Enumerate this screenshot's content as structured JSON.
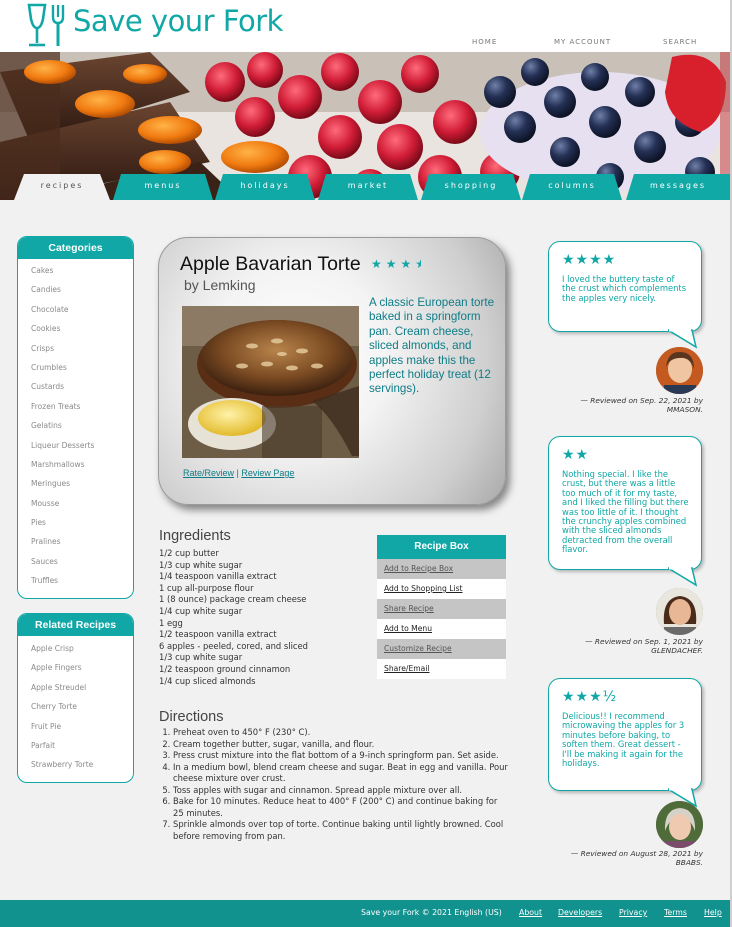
{
  "brand": {
    "name": "Save your Fork"
  },
  "topnav": {
    "home": "HOME",
    "account": "MY ACCOUNT",
    "search": "SEARCH"
  },
  "tabs": [
    {
      "label": "recipes",
      "active": true
    },
    {
      "label": "menus"
    },
    {
      "label": "holidays"
    },
    {
      "label": "market"
    },
    {
      "label": "shopping"
    },
    {
      "label": "columns"
    },
    {
      "label": "messages"
    }
  ],
  "categories": {
    "title": "Categories",
    "items": [
      "Cakes",
      "Candies",
      "Chocolate",
      "Cookies",
      "Crisps",
      "Crumbles",
      "Custards",
      "Frozen Treats",
      "Gelatins",
      "Liqueur Desserts",
      "Marshmallows",
      "Meringues",
      "Mousse",
      "Pies",
      "Pralines",
      "Sauces",
      "Truffles"
    ]
  },
  "related": {
    "title": "Related Recipes",
    "items": [
      "Apple Crisp",
      "Apple Fingers",
      "Apple Streudel",
      "Cherry Torte",
      "Fruit Pie",
      "Parfait",
      "Strawberry Torte"
    ]
  },
  "recipe": {
    "title": "Apple Bavarian Torte",
    "rating": 3.5,
    "byline": "by Lemking",
    "description": "A classic European torte baked in a springform pan. Cream cheese, sliced almonds, and apples make this the perfect holiday treat (12 servings).",
    "links": {
      "rate": "Rate/Review",
      "separator": " | ",
      "review": "Review Page"
    }
  },
  "ingredients": {
    "title": "Ingredients",
    "items": [
      "1/2 cup butter",
      "1/3 cup white sugar",
      "1/4 teaspoon vanilla extract",
      "1 cup all-purpose flour",
      "1 (8 ounce) package cream cheese",
      "1/4 cup white sugar",
      "1 egg",
      "1/2 teaspoon vanilla extract",
      "6 apples - peeled, cored, and sliced",
      "1/3 cup white sugar",
      "1/2 teaspoon ground cinnamon",
      "1/4 cup sliced almonds"
    ]
  },
  "recipe_box": {
    "title": "Recipe Box",
    "items": [
      "Add to Recipe Box",
      "Add to Shopping List",
      "Share Recipe",
      "Add to Menu",
      "Customize Recipe",
      "Share/Email"
    ]
  },
  "directions": {
    "title": "Directions",
    "items": [
      "Preheat oven to 450° F (230° C).",
      "Cream together butter, sugar, vanilla, and flour.",
      "Press crust mixture into the flat bottom of a 9-inch springform pan. Set aside.",
      "In a medium bowl, blend cream cheese and sugar. Beat in egg and vanilla. Pour cheese mixture over crust.",
      "Toss apples with sugar and cinnamon. Spread apple mixture over all.",
      "Bake for 10 minutes. Reduce heat to 400° F (200° C) and continue baking for 25 minutes.",
      "Sprinkle almonds over top of torte. Continue baking until lightly browned. Cool before removing from pan."
    ]
  },
  "reviews": [
    {
      "stars": "★★★★",
      "text": "I loved the buttery taste of the crust which complements the apples very nicely.",
      "meta": "— Reviewed on Sep. 22, 2021 by MMASON."
    },
    {
      "stars": "★★",
      "text": "Nothing special. I like the crust, but there was a little too much of it for my taste, and I liked the filling but there was too little of it. I thought the crunchy apples combined with the sliced almonds detracted from the overall flavor.",
      "meta": "— Reviewed on Sep. 1, 2021 by GLENDACHEF."
    },
    {
      "stars": "★★★½",
      "text": "Delicious!! I recommend microwaving the apples for 3 minutes before baking, to soften them. Great dessert - I'll be making it again for the holidays.",
      "meta": "— Reviewed on August 28, 2021 by BBABS."
    }
  ],
  "footer": {
    "copyright": "Save your Fork © 2021 English (US)",
    "links": [
      "About",
      "Developers",
      "Privacy",
      "Terms",
      "Help"
    ]
  },
  "colors": {
    "accent": "#10a7a6",
    "footer": "#11928f"
  }
}
